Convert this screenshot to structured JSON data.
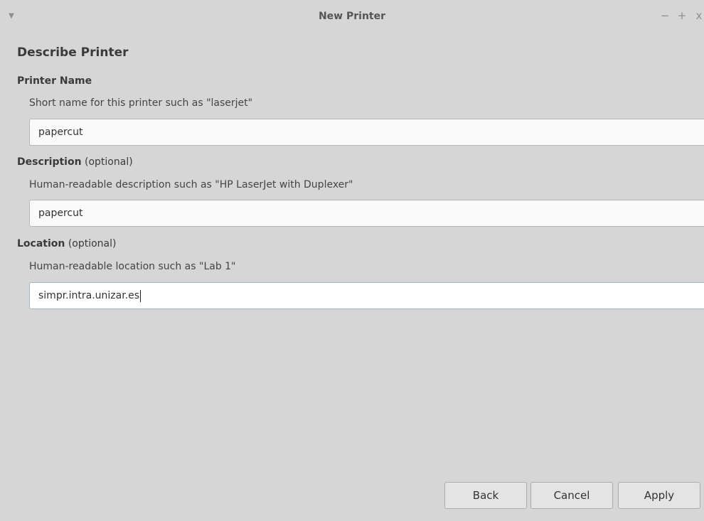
{
  "window": {
    "title": "New Printer",
    "menu_icon": "chevron-down-icon",
    "minimize_label": "−",
    "maximize_label": "+",
    "close_label": "x"
  },
  "page": {
    "heading": "Describe Printer"
  },
  "printer_name": {
    "label": "Printer Name",
    "hint": "Short name for this printer such as \"laserjet\"",
    "value": "papercut"
  },
  "description": {
    "label": "Description",
    "optional": "(optional)",
    "hint": "Human-readable description such as \"HP LaserJet with Duplexer\"",
    "value": "papercut"
  },
  "location": {
    "label": "Location",
    "optional": "(optional)",
    "hint": "Human-readable location such as \"Lab 1\"",
    "value": "simpr.intra.unizar.es"
  },
  "buttons": {
    "back": "Back",
    "cancel": "Cancel",
    "apply": "Apply"
  }
}
